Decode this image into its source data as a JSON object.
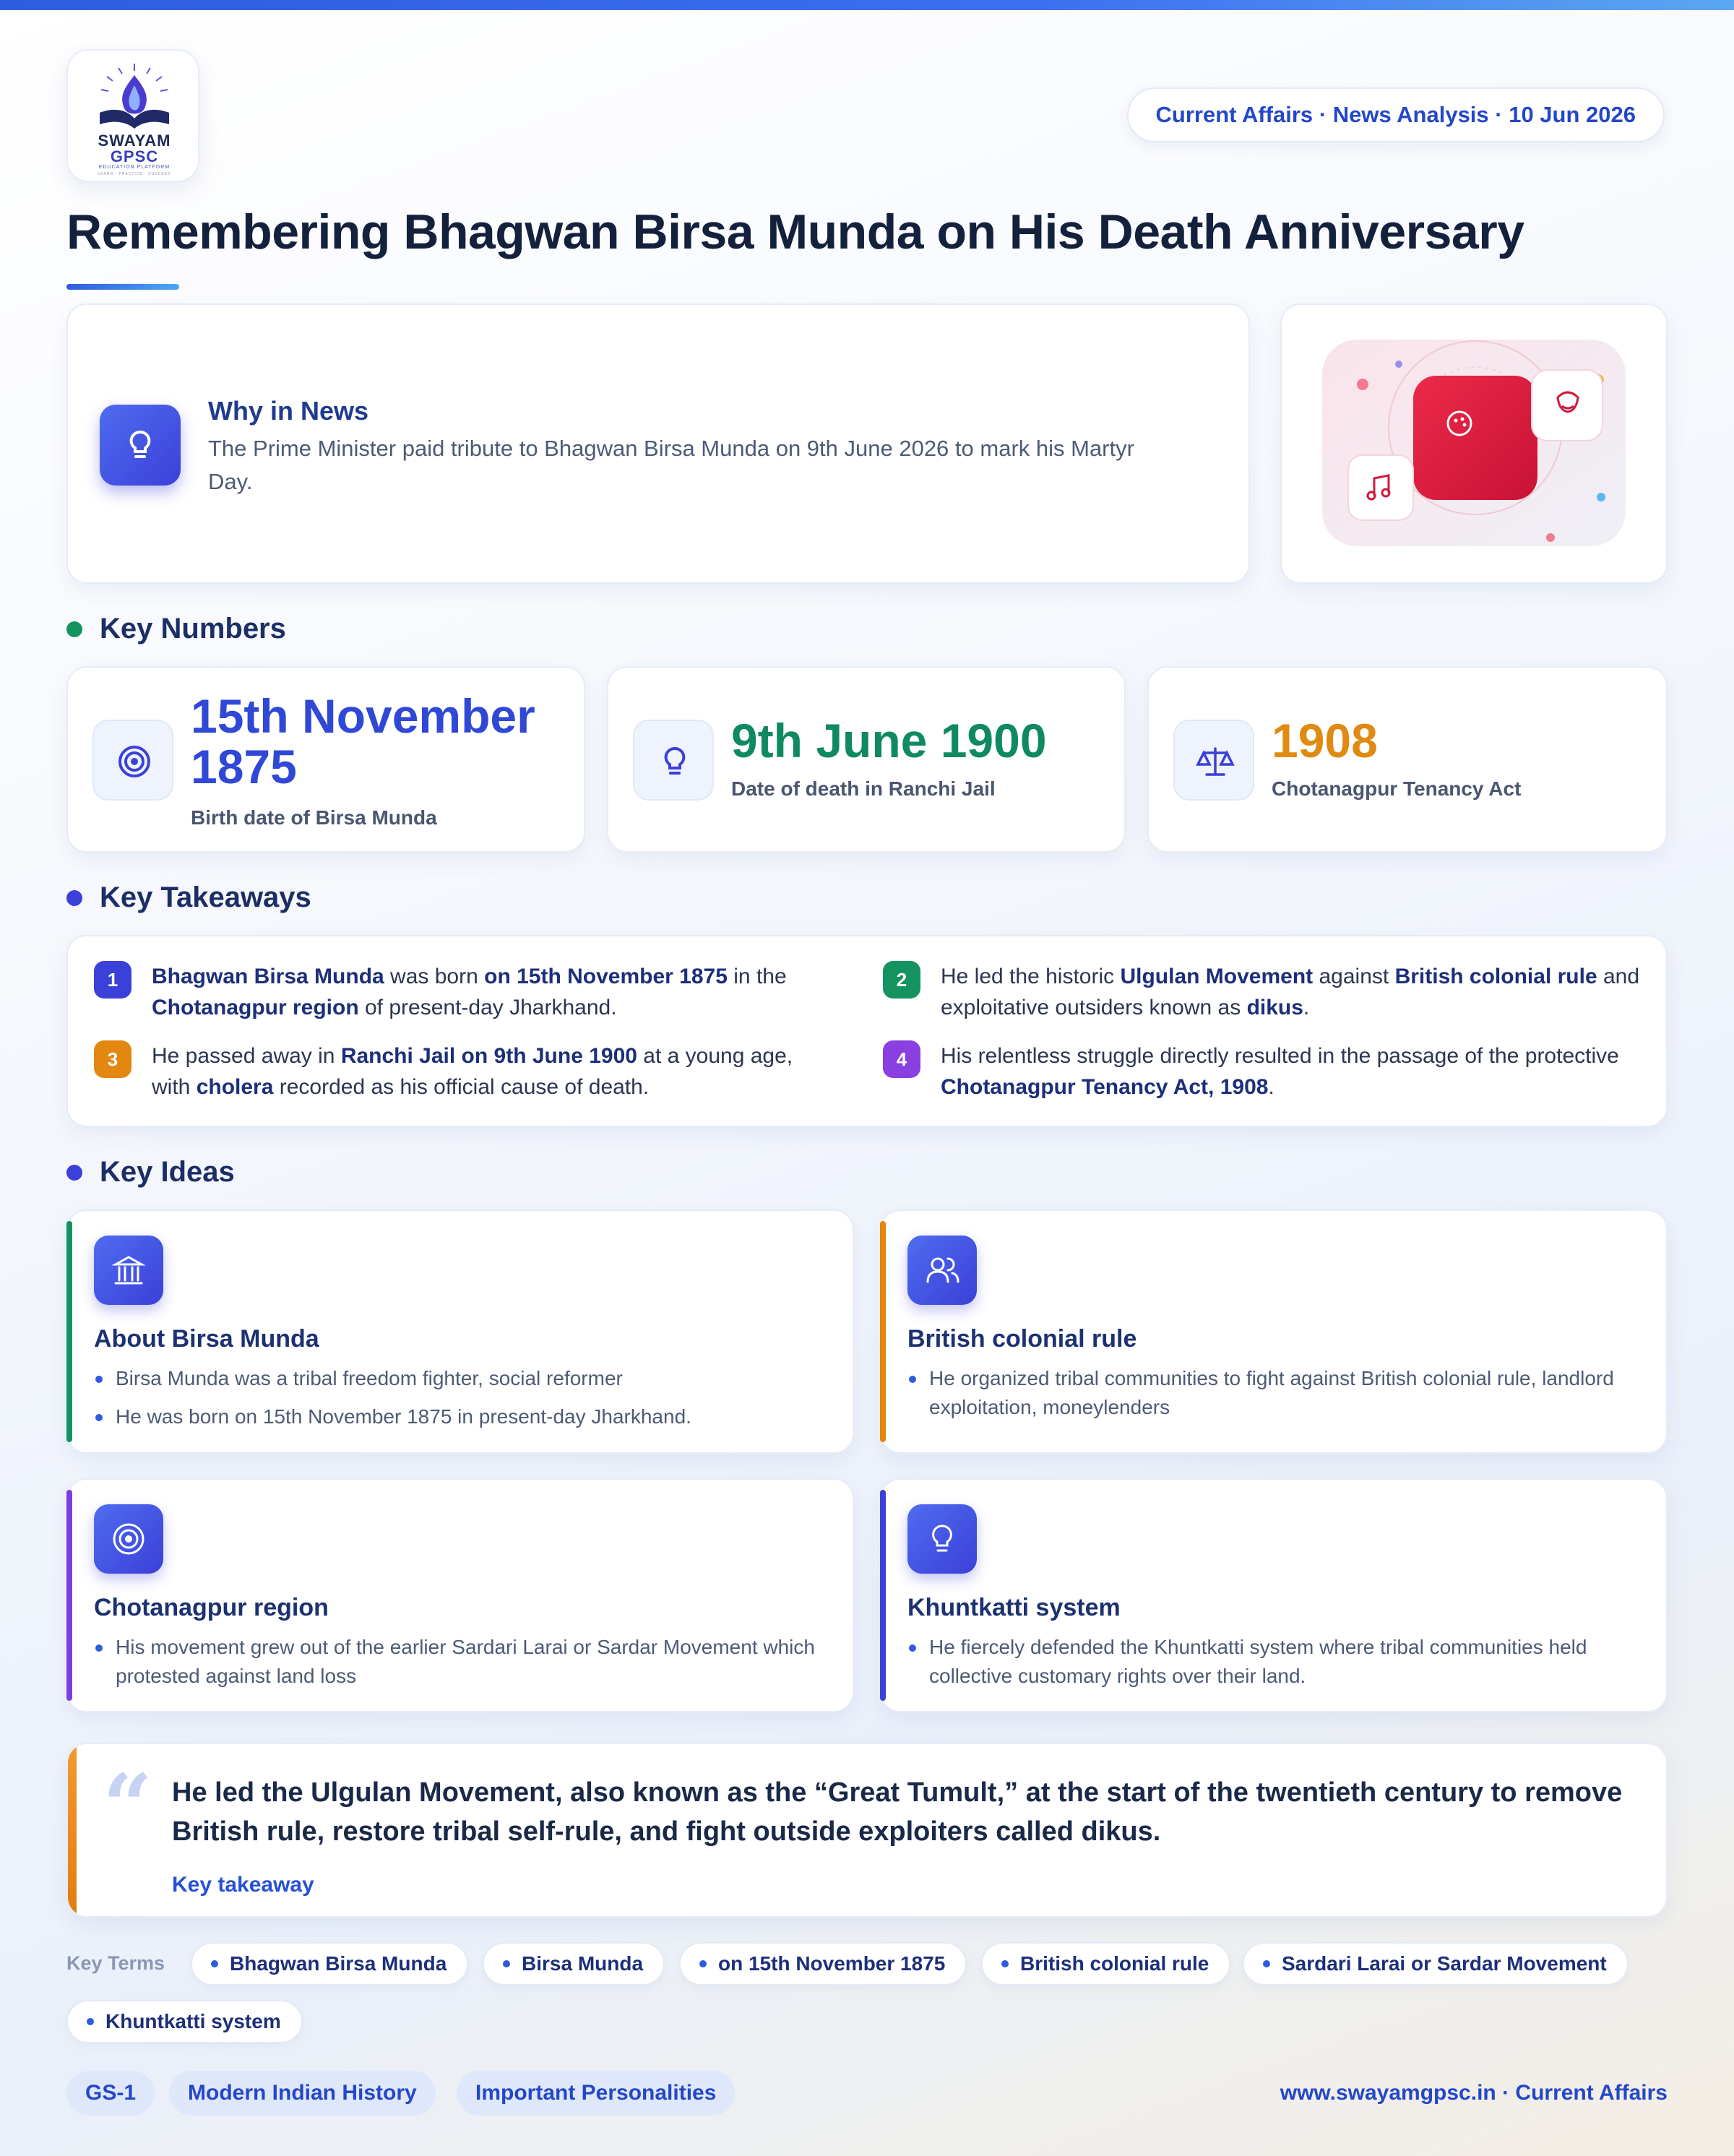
{
  "brand": {
    "logo_line1": "SWAYAM",
    "logo_line2": "GPSC",
    "logo_line3": "EDUCATION PLATFORM",
    "logo_line4": "LEARN · PRACTICE · SUCCEED"
  },
  "header": {
    "meta": "Current Affairs · News Analysis · 10 Jun 2026",
    "title": "Remembering Bhagwan Birsa Munda on His Death Anniversary"
  },
  "why_in_news": {
    "heading": "Why in News",
    "text": "The Prime Minister paid tribute to Bhagwan Birsa Munda on 9th June 2026 to mark his Martyr Day."
  },
  "key_numbers": {
    "heading": "Key Numbers",
    "items": [
      {
        "value": "15th November 1875",
        "caption": "Birth date of Birsa Munda",
        "color": "#2f48d6",
        "icon": "target-icon"
      },
      {
        "value": "9th June 1900",
        "caption": "Date of death in Ranchi Jail",
        "color": "#0f8a5f",
        "icon": "lightbulb-icon"
      },
      {
        "value": "1908",
        "caption": "Chotanagpur Tenancy Act",
        "color": "#e08a12",
        "icon": "scale-icon"
      }
    ]
  },
  "key_takeaways": {
    "heading": "Key Takeaways",
    "items": [
      {
        "num": "1",
        "color": "#3b40d8"
      },
      {
        "num": "2",
        "color": "#14935f"
      },
      {
        "num": "3",
        "color": "#e2870f"
      },
      {
        "num": "4",
        "color": "#8a3fe0"
      }
    ]
  },
  "key_ideas": {
    "heading": "Key Ideas",
    "items": [
      {
        "title": "About Birsa Munda",
        "icon": "bank-icon",
        "accent": "#14935f",
        "points": [
          "Birsa Munda was a tribal freedom fighter, social reformer",
          "He was born on 15th November 1875 in present-day Jharkhand."
        ]
      },
      {
        "title": "British colonial rule",
        "icon": "users-icon",
        "accent": "#e2870f",
        "points": [
          "He organized tribal communities to fight against British colonial rule, landlord exploitation, moneylenders"
        ]
      },
      {
        "title": "Chotanagpur region",
        "icon": "target-icon",
        "accent": "#7a3fe0",
        "points": [
          "His movement grew out of the earlier Sardari Larai or Sardar Movement which protested against land loss"
        ]
      },
      {
        "title": "Khuntkatti system",
        "icon": "lightbulb-icon",
        "accent": "#3b40d8",
        "points": [
          "He fiercely defended the Khuntkatti system where tribal communities held collective customary rights over their land."
        ]
      }
    ]
  },
  "quote": {
    "text": "He led the Ulgulan Movement, also known as the “Great Tumult,” at the start of the twentieth century to remove British rule, restore tribal self-rule, and fight outside exploiters called dikus.",
    "label": "Key takeaway"
  },
  "key_terms": {
    "label": "Key Terms",
    "items": [
      "Bhagwan Birsa Munda",
      "Birsa Munda",
      "on 15th November 1875",
      "British colonial rule",
      "Sardari Larai or Sardar Movement",
      "Khuntkatti system"
    ]
  },
  "tags": [
    "GS-1",
    "Modern Indian History",
    "Important Personalities"
  ],
  "footer": "www.swayamgpsc.in · Current Affairs",
  "colors": {
    "primary": "#2f5be0",
    "ink": "#14213d"
  }
}
